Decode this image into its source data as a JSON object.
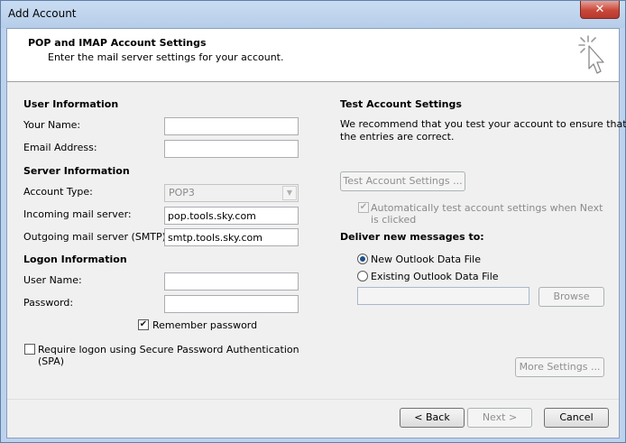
{
  "window": {
    "title": "Add Account",
    "close_symbol": "✕"
  },
  "header": {
    "title": "POP and IMAP Account Settings",
    "subtitle": "Enter the mail server settings for your account.",
    "icon": "cursor-sparkle-icon"
  },
  "user_info": {
    "section": "User Information",
    "your_name_label": "Your Name:",
    "your_name_value": "",
    "email_label": "Email Address:",
    "email_value": ""
  },
  "server_info": {
    "section": "Server Information",
    "account_type_label": "Account Type:",
    "account_type_value": "POP3",
    "incoming_label": "Incoming mail server:",
    "incoming_value": "pop.tools.sky.com",
    "outgoing_label": "Outgoing mail server (SMTP):",
    "outgoing_value": "smtp.tools.sky.com"
  },
  "logon_info": {
    "section": "Logon Information",
    "user_name_label": "User Name:",
    "user_name_value": "",
    "password_label": "Password:",
    "password_value": "",
    "remember_password_label": "Remember password",
    "remember_password_checked": true,
    "spa_label_line1": "Require logon using Secure Password Authentication",
    "spa_label_line2": "(SPA)",
    "spa_checked": false
  },
  "test_settings": {
    "section": "Test Account Settings",
    "description_line1": "We recommend that you test your account to ensure that",
    "description_line2": "the entries are correct.",
    "test_button": "Test Account Settings ...",
    "auto_test_line1": "Automatically test account settings when Next",
    "auto_test_line2": "is clicked",
    "auto_test_checked": true
  },
  "deliver": {
    "section": "Deliver new messages to:",
    "new_file_label": "New Outlook Data File",
    "existing_file_label": "Existing Outlook Data File",
    "selected": "new",
    "existing_path_value": "",
    "browse_button": "Browse"
  },
  "more_settings_button": "More Settings ...",
  "footer": {
    "back_button": "< Back",
    "next_button": "Next >",
    "cancel_button": "Cancel"
  }
}
